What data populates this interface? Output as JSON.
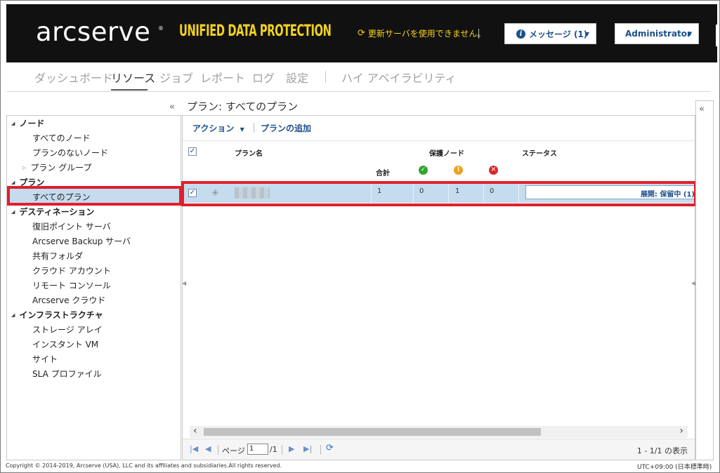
{
  "header": {
    "logo": "arcserve",
    "logo_reg": "®",
    "product": "UNIFIED DATA PROTECTION",
    "update_warning": "更新サーバを使用できません。",
    "messages_label": "メッセージ (1)",
    "user_label": "Administrator"
  },
  "nav": {
    "tabs": [
      "ダッシュボード",
      "リソース",
      "ジョブ",
      "レポート",
      "ログ",
      "設定",
      "ハイ アベイラビリティ"
    ],
    "active": "リソース"
  },
  "sidebar": {
    "groups": [
      {
        "label": "ノード",
        "items": [
          "すべてのノード",
          "プランのないノード"
        ],
        "sub": "プラン グループ"
      },
      {
        "label": "プラン",
        "items": [
          "すべてのプラン"
        ]
      },
      {
        "label": "デスティネーション",
        "items": [
          "復旧ポイント サーバ",
          "Arcserve Backup サーバ",
          "共有フォルダ",
          "クラウド アカウント",
          "リモート コンソール",
          "Arcserve クラウド"
        ]
      },
      {
        "label": "インフラストラクチャ",
        "items": [
          "ストレージ アレイ",
          "インスタント VM",
          "サイト",
          "SLA プロファイル"
        ]
      }
    ],
    "selected": "すべてのプラン"
  },
  "main": {
    "title": "プラン: すべてのプラン",
    "toolbar": {
      "actions": "アクション",
      "add_plan": "プランの追加"
    },
    "columns": {
      "plan_name": "プラン名",
      "protected_nodes": "保護ノード",
      "status": "ステータス",
      "total": "合計"
    },
    "rows": [
      {
        "checked": true,
        "total": "1",
        "ok": "0",
        "warn": "1",
        "err": "0",
        "status": "展開: 保留中 (1)"
      }
    ],
    "pager": {
      "page_label": "ページ",
      "page": "1",
      "of": "/1",
      "info": "1 - 1/1 の表示"
    }
  },
  "footer": {
    "copyright": "Copyright © 2014-2019, Arcserve (USA), LLC and its affiliates and subsidiaries.All rights reserved.",
    "timezone": "UTC+09:00 (日本標準時)"
  },
  "colors": {
    "header_bg": "#111111",
    "product_yellow": "#f4d21f",
    "link_blue": "#1c4f8c",
    "selection_blue": "#c5dcef",
    "highlight_red": "#e0202b"
  }
}
